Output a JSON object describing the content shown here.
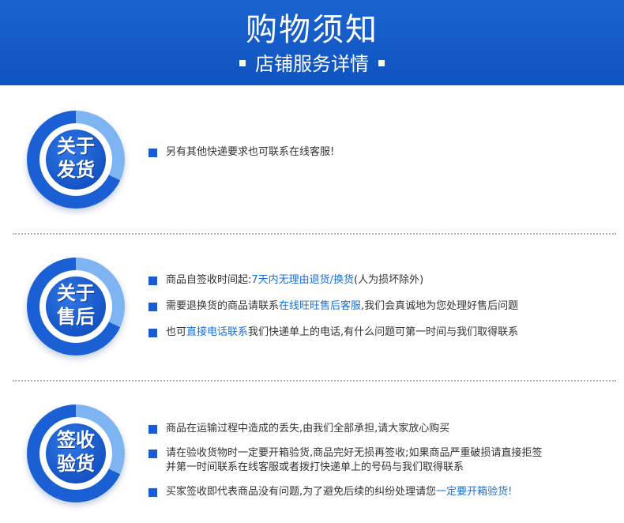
{
  "banner": {
    "title": "购物须知",
    "subtitle": "店铺服务详情"
  },
  "sections": [
    {
      "badge": [
        "关于",
        "发货"
      ],
      "items": [
        {
          "parts": [
            "另有其他快递要求也可联系在线客服!"
          ]
        }
      ]
    },
    {
      "badge": [
        "关于",
        "售后"
      ],
      "items": [
        {
          "parts": [
            "商品自签收时间起:",
            "7天内无理由退货/换货",
            "(人为损坏除外)"
          ]
        },
        {
          "parts": [
            "需要退换货的商品请联系",
            "在线旺旺售后客服",
            ",我们会真诚地为您处理好售后问题"
          ]
        },
        {
          "parts": [
            "也可",
            "直接电话联系",
            "我们快递单上的电话,有什么问题可第一时间与我们取得联系"
          ]
        }
      ]
    },
    {
      "badge": [
        "签收",
        "验货"
      ],
      "items": [
        {
          "parts": [
            "商品在运输过程中造成的丢失,由我们全部承担,请大家放心购买"
          ]
        },
        {
          "parts": [
            "请在验收货物时一定要开箱验货,商品完好无损再签收;如果商品严重破损请直接拒签",
            "并第一时间联系在线客服或者拨打快递单上的号码与我们取得联系"
          ]
        },
        {
          "parts": [
            "买家签收即代表商品没有问题,为了避免后续的纠纷处理请您",
            "一定要开箱验货!"
          ]
        }
      ]
    }
  ],
  "colors": {
    "brand_blue": "#1a5bd1",
    "highlight_text": "#1a6fd8",
    "ring_light": "#7fb4f2"
  },
  "icons": {
    "bullet": "square-bullet-icon",
    "banner_marker": "square-marker-icon"
  }
}
